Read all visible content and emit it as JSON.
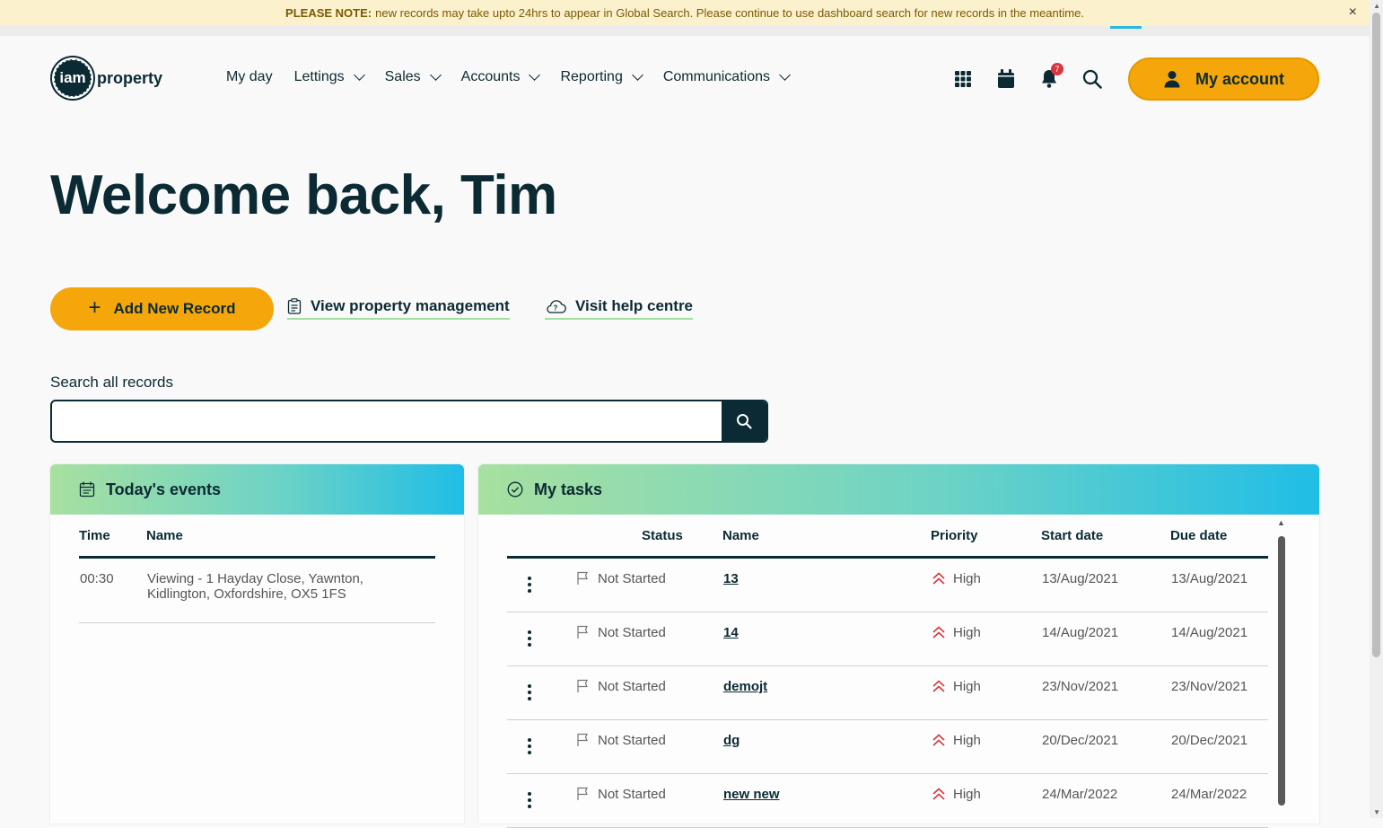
{
  "notice": {
    "bold": "PLEASE NOTE:",
    "text": "new records may take upto 24hrs to appear in Global Search. Please continue to use dashboard search for new records in the meantime.",
    "close": "×"
  },
  "logo": {
    "mark": "iam",
    "text": "property"
  },
  "nav": {
    "items": [
      {
        "label": "My day",
        "dropdown": false
      },
      {
        "label": "Lettings",
        "dropdown": true
      },
      {
        "label": "Sales",
        "dropdown": true
      },
      {
        "label": "Accounts",
        "dropdown": true
      },
      {
        "label": "Reporting",
        "dropdown": true
      },
      {
        "label": "Communications",
        "dropdown": true
      }
    ]
  },
  "header": {
    "notifications_count": "7",
    "account_label": "My account"
  },
  "welcome": {
    "title": "Welcome back, Tim"
  },
  "actions": {
    "add_record": "Add New Record",
    "view_property": "View property management",
    "help_centre": "Visit help centre"
  },
  "search": {
    "label": "Search all records",
    "placeholder": ""
  },
  "events": {
    "title": "Today's events",
    "columns": [
      "Time",
      "Name"
    ],
    "rows": [
      {
        "time": "00:30",
        "name_line1": "Viewing - 1 Hayday Close, Yawnton,",
        "name_line2": "Kidlington, Oxfordshire, OX5 1FS"
      }
    ]
  },
  "tasks": {
    "title": "My tasks",
    "columns": [
      "Status",
      "Name",
      "Priority",
      "Start date",
      "Due date"
    ],
    "rows": [
      {
        "status": "Not Started",
        "name": "13",
        "priority": "High",
        "start": "13/Aug/2021",
        "due": "13/Aug/2021"
      },
      {
        "status": "Not Started",
        "name": "14",
        "priority": "High",
        "start": "14/Aug/2021",
        "due": "14/Aug/2021"
      },
      {
        "status": "Not Started",
        "name": "demojt",
        "priority": "High",
        "start": "23/Nov/2021",
        "due": "23/Nov/2021"
      },
      {
        "status": "Not Started",
        "name": "dg",
        "priority": "High",
        "start": "20/Dec/2021",
        "due": "20/Dec/2021"
      },
      {
        "status": "Not Started",
        "name": "new new",
        "priority": "High",
        "start": "24/Mar/2022",
        "due": "24/Mar/2022"
      }
    ]
  },
  "colors": {
    "brand_dark": "#0b2a33",
    "accent_orange": "#f5a60a",
    "priority_red": "#d9363e",
    "link_underline": "#9fe0a0"
  }
}
